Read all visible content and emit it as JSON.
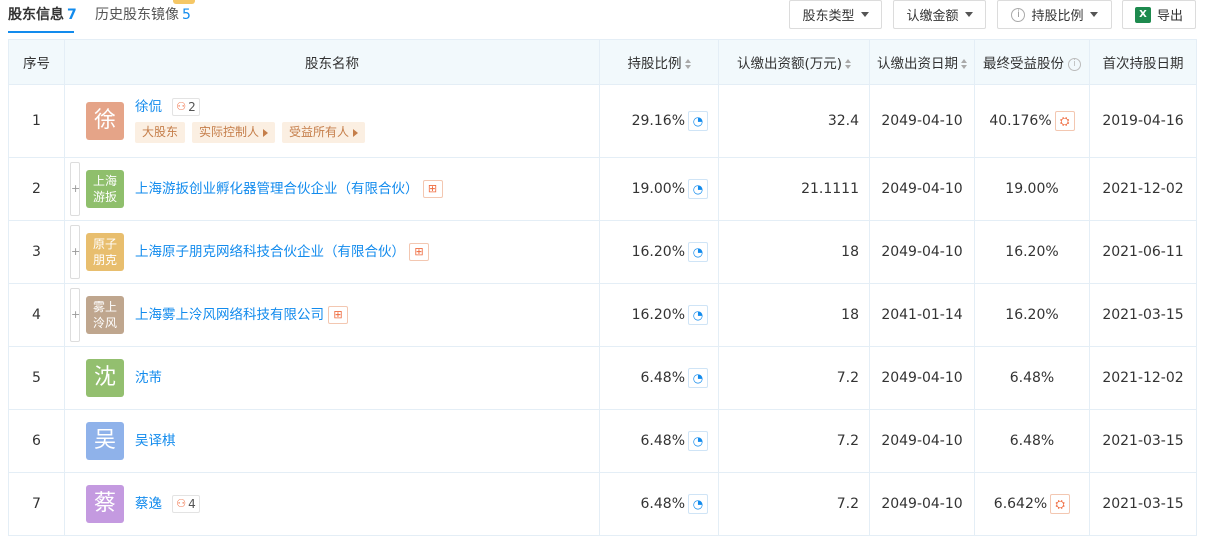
{
  "tabs": [
    {
      "label": "股东信息",
      "count": "7"
    },
    {
      "label": "历史股东镜像",
      "count": "5"
    }
  ],
  "toolbar": {
    "shareholder_type": "股东类型",
    "subscribed_amount": "认缴金额",
    "holding_ratio": "持股比例",
    "export": "导出"
  },
  "columns": {
    "index": "序号",
    "name": "股东名称",
    "ratio": "持股比例",
    "capital": "认缴出资额(万元)",
    "date": "认缴出资日期",
    "beneficial": "最终受益股份",
    "first_date": "首次持股日期"
  },
  "icons": {
    "pie": "pie-chart-icon",
    "relation": "relation-graph-icon",
    "equity": "equity-structure-icon",
    "share": "share-penetration-icon",
    "info": "info-icon",
    "excel": "excel-icon"
  },
  "colors": {
    "link": "#128bed",
    "tag_bg": "#fbefe2",
    "tag_text": "#c57e4a",
    "header_bg": "#f2f9fc"
  },
  "rows": [
    {
      "index": "1",
      "avatar": "徐",
      "avatar_color": "#e5a488",
      "name": "徐侃",
      "rel_count": "2",
      "tags": [
        "大股东",
        "实际控制人",
        "受益所有人"
      ],
      "ratio": "29.16%",
      "capital": "32.4",
      "date": "2049-04-10",
      "beneficial": "40.176%",
      "first_date": "2019-04-16"
    },
    {
      "index": "2",
      "avatar": "上海游扳",
      "avatar_color": "#8fbf6c",
      "name": "上海游扳创业孵化器管理合伙企业（有限合伙）",
      "ratio": "19.00%",
      "capital": "21.1111",
      "date": "2049-04-10",
      "beneficial": "19.00%",
      "first_date": "2021-12-02"
    },
    {
      "index": "3",
      "avatar": "原子朋克",
      "avatar_color": "#e8be6e",
      "name": "上海原子朋克网络科技合伙企业（有限合伙）",
      "ratio": "16.20%",
      "capital": "18",
      "date": "2049-04-10",
      "beneficial": "16.20%",
      "first_date": "2021-06-11"
    },
    {
      "index": "4",
      "avatar": "雾上泠风",
      "avatar_color": "#bfa68e",
      "name": "上海雾上泠风网络科技有限公司",
      "ratio": "16.20%",
      "capital": "18",
      "date": "2041-01-14",
      "beneficial": "16.20%",
      "first_date": "2021-03-15"
    },
    {
      "index": "5",
      "avatar": "沈",
      "avatar_color": "#93bf6f",
      "name": "沈芾",
      "ratio": "6.48%",
      "capital": "7.2",
      "date": "2049-04-10",
      "beneficial": "6.48%",
      "first_date": "2021-12-02"
    },
    {
      "index": "6",
      "avatar": "吴",
      "avatar_color": "#8fb2ea",
      "name": "吴译棋",
      "ratio": "6.48%",
      "capital": "7.2",
      "date": "2049-04-10",
      "beneficial": "6.48%",
      "first_date": "2021-03-15"
    },
    {
      "index": "7",
      "avatar": "蔡",
      "avatar_color": "#c49ae0",
      "name": "蔡逸",
      "rel_count": "4",
      "ratio": "6.48%",
      "capital": "7.2",
      "date": "2049-04-10",
      "beneficial": "6.642%",
      "first_date": "2021-03-15"
    }
  ]
}
